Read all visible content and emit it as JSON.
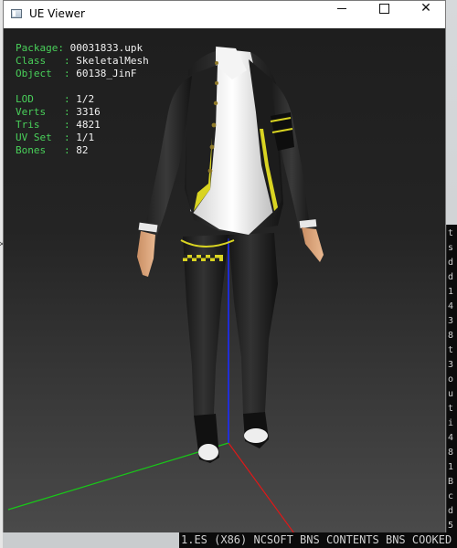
{
  "window": {
    "title": "UE Viewer",
    "controls": {
      "minimize": "",
      "maximize": "",
      "close": "✕"
    }
  },
  "info": {
    "package_label": "Package",
    "package": "00031833.upk",
    "class_label": "Class",
    "class": "SkeletalMesh",
    "object_label": "Object",
    "object": "60138_JinF",
    "lod_label": "LOD",
    "lod": "1/2",
    "verts_label": "Verts",
    "verts": "3316",
    "tris_label": "Tris",
    "tris": "4821",
    "uvset_label": "UV Set",
    "uvset": "1/1",
    "bones_label": "Bones",
    "bones": "82"
  },
  "colors": {
    "label": "#49d05a",
    "value": "#f2f2f2",
    "axis_x": "#e01818",
    "axis_y": "#18c818",
    "axis_z": "#1b2cff",
    "accent_trim": "#d9d422"
  },
  "background": {
    "console_chars": [
      "t",
      "s",
      "d",
      "d",
      "1",
      "4",
      "3",
      "8",
      "t",
      "3",
      "o",
      "u",
      "t",
      "i",
      "4",
      "8",
      "1",
      "B",
      "c",
      "d",
      "5",
      "t"
    ],
    "bottom_strip_text": "1.ES  (X86) NCSOFT  BNS  CONTENTS  BNS  COOKED"
  }
}
